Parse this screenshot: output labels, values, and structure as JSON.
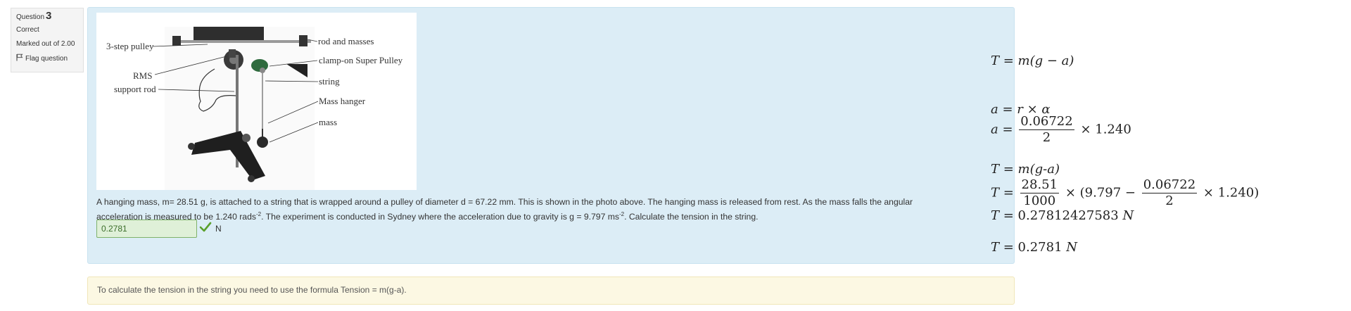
{
  "question_info": {
    "prefix": "Question",
    "number": "3",
    "state": "Correct",
    "grade": "Marked out of 2.00",
    "flag_label": "Flag question"
  },
  "figure": {
    "labels": {
      "pulley": "3-step pulley",
      "rod": "rod and masses",
      "clamp": "clamp-on Super Pulley",
      "rms": "RMS",
      "support": "support rod",
      "string": "string",
      "hanger": "Mass hanger",
      "mass": "mass"
    }
  },
  "question": {
    "line1": "A hanging mass, m= 28.51 g, is attached to a string that is wrapped around a pulley of diameter d = 67.22 mm. This is shown in the photo above. The hanging mass is released from rest. As the mass falls the angular",
    "line2_a": "acceleration is measured to be 1.240 rads",
    "line2_sup1": "-2",
    "line2_b": ". The experiment is conducted in Sydney where the acceleration due to gravity is g = 9.797 ms",
    "line2_sup2": "-2",
    "line2_c": ". Calculate the tension in the string.",
    "answer_value": "0.2781",
    "unit": "N"
  },
  "feedback": {
    "text": "To calculate the tension in the string you need to use the formula Tension = m(g-a)."
  },
  "working": {
    "eq1": "T = m(g − a)",
    "eq2": "a  =  r × α",
    "eq3_lhs": "a  =",
    "eq3_num": "0.06722",
    "eq3_den": "2",
    "eq3_rhs": "× 1.240",
    "eq4": "T = m(g-a)",
    "eq5_lhs": "T  =",
    "eq5_num1": "28.51",
    "eq5_den1": "1000",
    "eq5_mid": "× (9.797 −",
    "eq5_num2": "0.06722",
    "eq5_den2": "2",
    "eq5_end": "× 1.240)",
    "eq6_lhs": "T  =",
    "eq6_val": "0.27812427583",
    "eq6_unit": "N",
    "eq7_lhs": "T  =",
    "eq7_val": "0.2781",
    "eq7_unit": "N"
  },
  "colors": {
    "correct_bg": "#dff0d8",
    "correct_tick": "#5aa02c",
    "formulation_bg": "#dcedf6",
    "feedback_bg": "#fcf8e3"
  }
}
